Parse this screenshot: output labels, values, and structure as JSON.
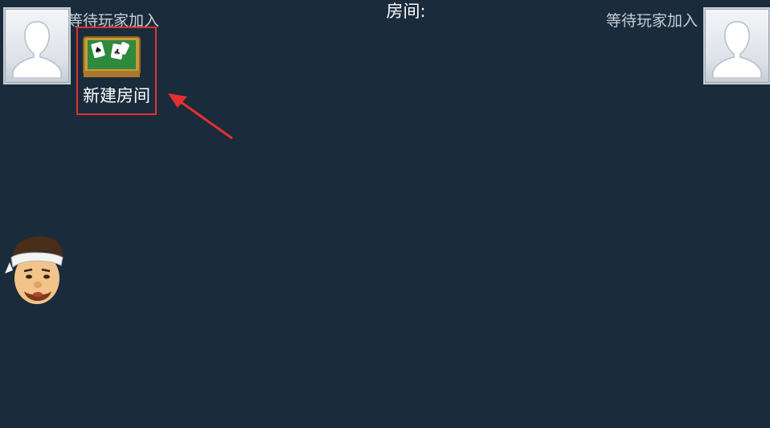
{
  "header": {
    "room_label": "房间:"
  },
  "seats": {
    "left": {
      "status": "等待玩家加入",
      "icon": "empty-avatar-icon"
    },
    "right": {
      "status": "等待玩家加入",
      "icon": "empty-avatar-icon"
    }
  },
  "actions": {
    "create_room_label": "新建房间",
    "create_room_icon": "card-table-icon"
  },
  "player": {
    "icon": "player-character-avatar"
  },
  "annotation": {
    "highlight_color": "#e53030",
    "pointer": "red-arrow-icon"
  },
  "colors": {
    "background": "#1a2b3b",
    "text": "#ffffff",
    "waiting_text": "#c6ced6",
    "table_felt": "#2e8a3c",
    "table_frame": "#c89a3c"
  }
}
